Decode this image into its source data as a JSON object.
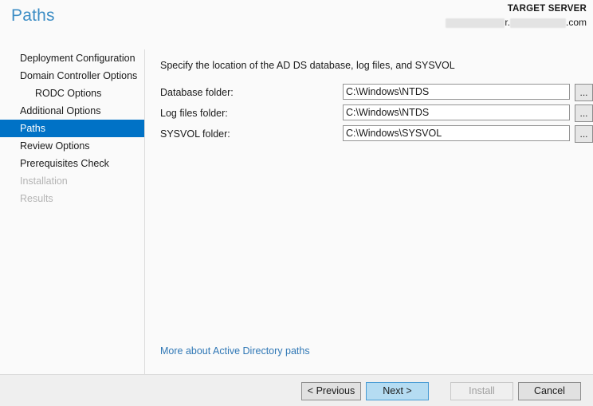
{
  "header": {
    "title": "Paths",
    "target_server_label": "TARGET SERVER",
    "target_server_separator": "r.",
    "target_server_suffix": ".com"
  },
  "sidebar": {
    "items": [
      {
        "label": "Deployment Configuration",
        "state": "normal",
        "indent": false
      },
      {
        "label": "Domain Controller Options",
        "state": "normal",
        "indent": false
      },
      {
        "label": "RODC Options",
        "state": "normal",
        "indent": true
      },
      {
        "label": "Additional Options",
        "state": "normal",
        "indent": false
      },
      {
        "label": "Paths",
        "state": "selected",
        "indent": false
      },
      {
        "label": "Review Options",
        "state": "normal",
        "indent": false
      },
      {
        "label": "Prerequisites Check",
        "state": "normal",
        "indent": false
      },
      {
        "label": "Installation",
        "state": "disabled",
        "indent": false
      },
      {
        "label": "Results",
        "state": "disabled",
        "indent": false
      }
    ]
  },
  "main": {
    "intro": "Specify the location of the AD DS database, log files, and SYSVOL",
    "fields": [
      {
        "label": "Database folder:",
        "value": "C:\\Windows\\NTDS",
        "browse_label": "..."
      },
      {
        "label": "Log files folder:",
        "value": "C:\\Windows\\NTDS",
        "browse_label": "..."
      },
      {
        "label": "SYSVOL folder:",
        "value": "C:\\Windows\\SYSVOL",
        "browse_label": "..."
      }
    ],
    "more_link": "More about Active Directory paths"
  },
  "footer": {
    "previous_label": "< Previous",
    "next_label": "Next >",
    "install_label": "Install",
    "cancel_label": "Cancel"
  },
  "colors": {
    "accent_blue": "#0072c6",
    "title_blue": "#3c8dc5",
    "link_blue": "#2f77b5",
    "next_button_fill": "#b5dcf2",
    "footer_bg": "#efefef",
    "page_bg": "#fafafa"
  }
}
